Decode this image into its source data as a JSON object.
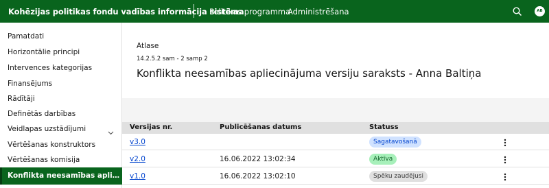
{
  "header": {
    "app_title": "Kohēzijas politikas fondu vadības informācija sistēma",
    "nav": [
      "Politikas programma",
      "Administrēšana"
    ],
    "avatar_initials": "AB",
    "brand_color": "#09641d"
  },
  "sidebar": {
    "items": [
      {
        "label": "Pamatdati"
      },
      {
        "label": "Horizontālie principi"
      },
      {
        "label": "Intervences kategorijas"
      },
      {
        "label": "Finansējums"
      },
      {
        "label": "Rādītāji"
      },
      {
        "label": "Definētās darbības"
      },
      {
        "label": "Veidlapas uzstādījumi"
      },
      {
        "label": "Vērtēšanas konstruktors"
      },
      {
        "label": "Vērtēšanas komisija"
      },
      {
        "label": "Konflikta neesamības apliecinā..."
      }
    ],
    "active_index": 9
  },
  "main": {
    "breadcrumb": "Atlase",
    "sub_breadcrumb": "14.2.5.2 sam - 2 samp 2",
    "title": "Konflikta neesamības apliecinājuma versiju saraksts - Anna Baltiņa"
  },
  "table": {
    "columns": [
      "Versijas nr.",
      "Publicēšanas datums",
      "Statuss"
    ],
    "rows": [
      {
        "version": "v3.0",
        "date": "",
        "status": "Sagatavošanā",
        "status_color": "#d0e2ff"
      },
      {
        "version": "v2.0",
        "date": "16.06.2022 13:02:34",
        "status": "Aktīva",
        "status_color": "#a7f0ba"
      },
      {
        "version": "v1.0",
        "date": "16.06.2022 13:02:10",
        "status": "Spēku zaudējusi",
        "status_color": "#e0e0e0"
      }
    ]
  }
}
